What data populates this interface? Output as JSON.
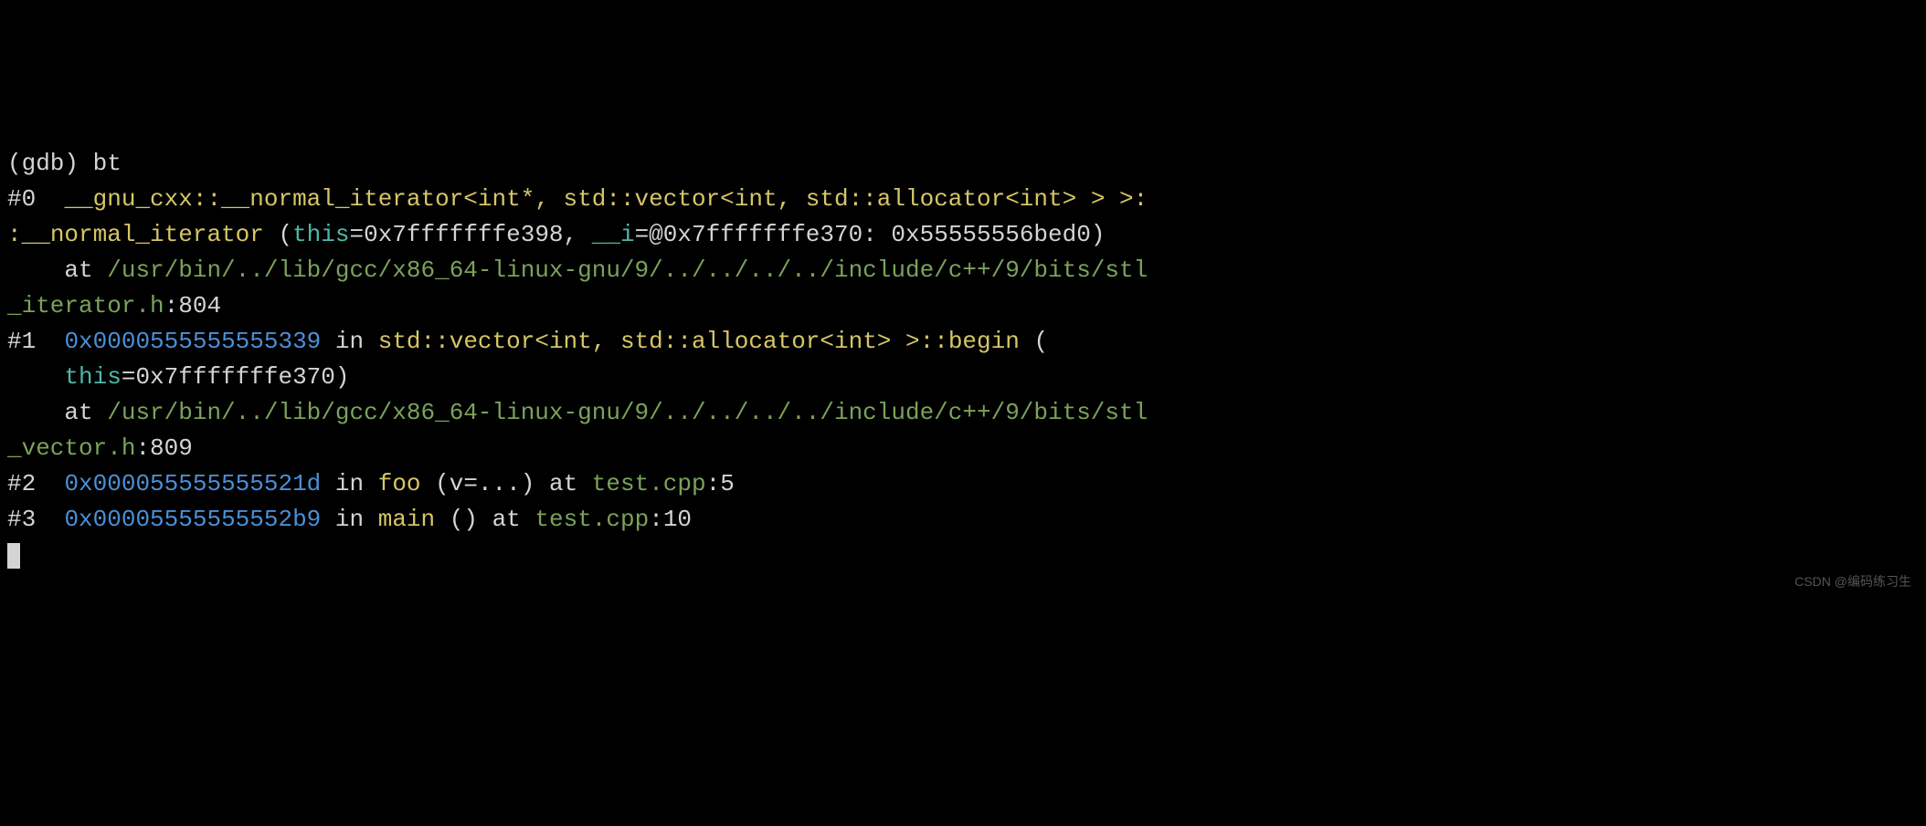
{
  "prompt": "(gdb) ",
  "command": "bt",
  "frames": [
    {
      "num": "#0",
      "indent": "  ",
      "func_line1": "__gnu_cxx::__normal_iterator<int*, std::vector<int, std::allocator<int> > >:",
      "func_line2_prefix": ":",
      "func_name2": "__normal_iterator",
      "paren_open": " (",
      "param1_name": "this",
      "param1_eq": "=0x7fffffffe398, ",
      "param2_name": "__i",
      "param2_eq": "=@0x7fffffffe370: 0x55555556bed0)",
      "at_indent": "    ",
      "at": "at ",
      "path1": "/usr/bin/../lib/gcc/x86_64-linux-gnu/9/../../../../include/c++/9/bits/stl",
      "path2": "_iterator.h",
      "colon": ":",
      "line": "804"
    },
    {
      "num": "#1",
      "indent": "  ",
      "addr": "0x0000555555555339",
      "in": " in ",
      "func": "std::vector<int, std::allocator<int> >::begin",
      "paren": " (",
      "this_indent": "    ",
      "param1_name": "this",
      "param1_eq": "=0x7fffffffe370)",
      "at_indent": "    ",
      "at": "at ",
      "path1": "/usr/bin/../lib/gcc/x86_64-linux-gnu/9/../../../../include/c++/9/bits/stl",
      "path2": "_vector.h",
      "colon": ":",
      "line": "809"
    },
    {
      "num": "#2",
      "indent": "  ",
      "addr": "0x000055555555521d",
      "in": " in ",
      "func": "foo",
      "params": " (v=...) ",
      "at": "at ",
      "path": "test.cpp",
      "colon": ":",
      "line": "5"
    },
    {
      "num": "#3",
      "indent": "  ",
      "addr": "0x00005555555552b9",
      "in": " in ",
      "func": "main",
      "params": " () ",
      "at": "at ",
      "path": "test.cpp",
      "colon": ":",
      "line": "10"
    }
  ],
  "watermark": "CSDN @编码练习生"
}
